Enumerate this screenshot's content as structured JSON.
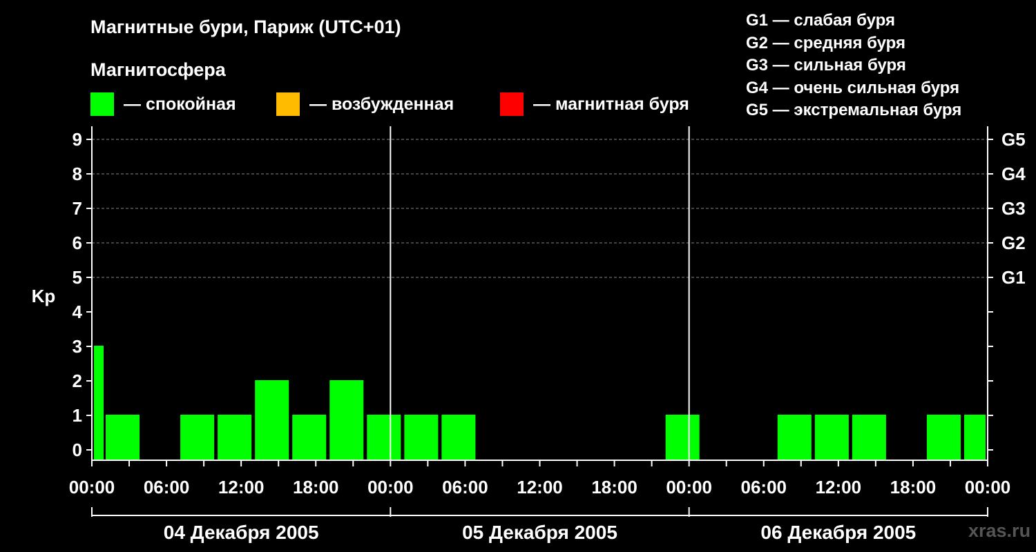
{
  "title": "Магнитные бури, Париж (UTC+01)",
  "legend": {
    "heading": "Магнитосфера",
    "items": [
      {
        "label": "— спокойная",
        "color": "#00ff00"
      },
      {
        "label": "— возбужденная",
        "color": "#ffbb00"
      },
      {
        "label": "— магнитная буря",
        "color": "#ff0000"
      }
    ]
  },
  "storm_scale": [
    "G1 — слабая буря",
    "G2 — средняя буря",
    "G3 — сильная буря",
    "G4 — очень сильная буря",
    "G5 — экстремальная буря"
  ],
  "watermark": "xras.ru",
  "chart_data": {
    "type": "bar",
    "ylabel": "Kp",
    "xlabel": "",
    "ylim": [
      0,
      9
    ],
    "yticks": [
      0,
      1,
      2,
      3,
      4,
      5,
      6,
      7,
      8,
      9
    ],
    "right_axis_labels": [
      {
        "kp": 5,
        "label": "G1"
      },
      {
        "kp": 6,
        "label": "G2"
      },
      {
        "kp": 7,
        "label": "G3"
      },
      {
        "kp": 8,
        "label": "G4"
      },
      {
        "kp": 9,
        "label": "G5"
      }
    ],
    "xticks": [
      "00:00",
      "06:00",
      "12:00",
      "18:00",
      "00:00",
      "06:00",
      "12:00",
      "18:00",
      "00:00",
      "06:00",
      "12:00",
      "18:00",
      "00:00"
    ],
    "days": [
      "04 Декабря 2005",
      "05 Декабря 2005",
      "06 Декабря 2005"
    ],
    "grid": true,
    "series": [
      {
        "values": [
          {
            "start_hour": 0,
            "end_hour": 1,
            "kp": 3
          },
          {
            "start_hour": 1,
            "end_hour": 4,
            "kp": 1
          },
          {
            "start_hour": 4,
            "end_hour": 7,
            "kp": 0
          },
          {
            "start_hour": 7,
            "end_hour": 10,
            "kp": 1
          },
          {
            "start_hour": 10,
            "end_hour": 13,
            "kp": 1
          },
          {
            "start_hour": 13,
            "end_hour": 16,
            "kp": 2
          },
          {
            "start_hour": 16,
            "end_hour": 19,
            "kp": 1
          },
          {
            "start_hour": 19,
            "end_hour": 22,
            "kp": 2
          },
          {
            "start_hour": 22,
            "end_hour": 25,
            "kp": 1
          },
          {
            "start_hour": 25,
            "end_hour": 28,
            "kp": 1
          },
          {
            "start_hour": 28,
            "end_hour": 31,
            "kp": 1
          },
          {
            "start_hour": 31,
            "end_hour": 34,
            "kp": 0
          },
          {
            "start_hour": 34,
            "end_hour": 37,
            "kp": 0
          },
          {
            "start_hour": 37,
            "end_hour": 40,
            "kp": 0
          },
          {
            "start_hour": 40,
            "end_hour": 43,
            "kp": 0
          },
          {
            "start_hour": 43,
            "end_hour": 46,
            "kp": 0
          },
          {
            "start_hour": 46,
            "end_hour": 49,
            "kp": 1
          },
          {
            "start_hour": 49,
            "end_hour": 52,
            "kp": 0
          },
          {
            "start_hour": 52,
            "end_hour": 55,
            "kp": 0
          },
          {
            "start_hour": 55,
            "end_hour": 58,
            "kp": 1
          },
          {
            "start_hour": 58,
            "end_hour": 61,
            "kp": 1
          },
          {
            "start_hour": 61,
            "end_hour": 64,
            "kp": 1
          },
          {
            "start_hour": 64,
            "end_hour": 67,
            "kp": 0
          },
          {
            "start_hour": 67,
            "end_hour": 70,
            "kp": 1
          },
          {
            "start_hour": 70,
            "end_hour": 72,
            "kp": 1
          }
        ]
      }
    ]
  }
}
